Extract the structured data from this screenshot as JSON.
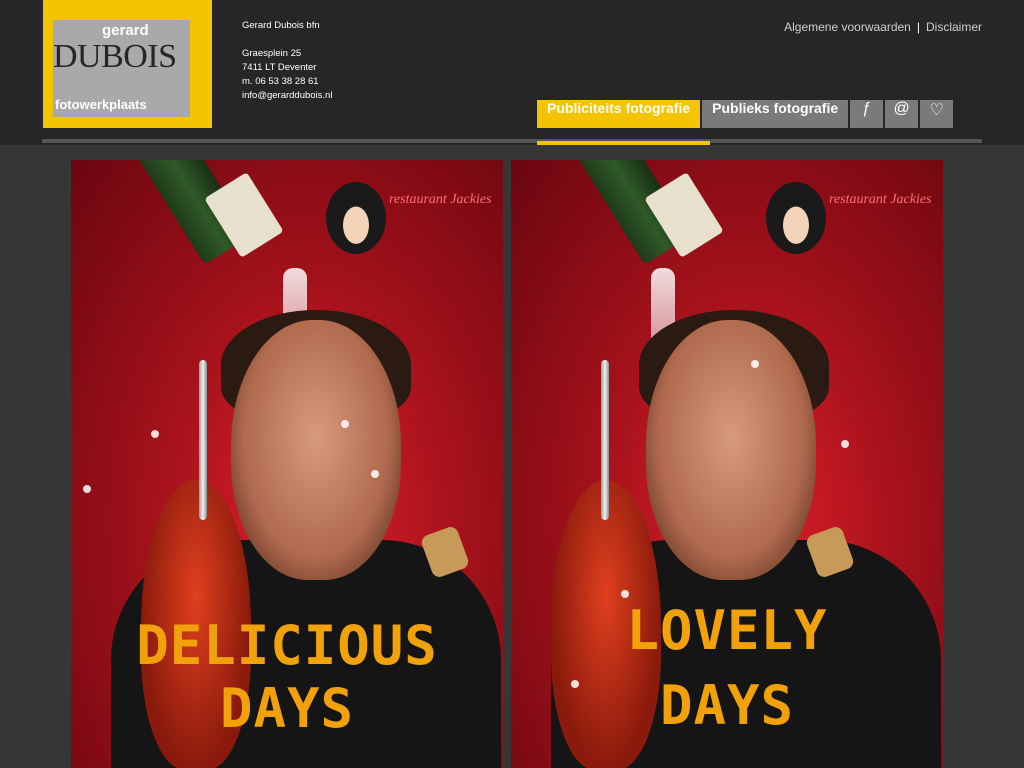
{
  "logo": {
    "first_name": "gerard",
    "last_name": "DUBOIS",
    "tagline": "fotowerkplaats"
  },
  "contact": {
    "company": "Gerard Dubois bfn",
    "street": "Graesplein 25",
    "city": "7411 LT Deventer",
    "phone": "m. 06 53 38 28 61",
    "email": "info@gerarddubois.nl"
  },
  "toplinks": {
    "terms": "Algemene voorwaarden",
    "separator": "|",
    "disclaimer": "Disclaimer"
  },
  "nav": {
    "items": [
      {
        "label": "Publiciteits fotografie",
        "active": true
      },
      {
        "label": "Publieks fotografie",
        "active": false
      }
    ],
    "icons": [
      {
        "name": "facebook-icon",
        "glyph": "ƒ"
      },
      {
        "name": "at-icon",
        "glyph": "@"
      },
      {
        "name": "heart-icon",
        "glyph": "♡"
      }
    ]
  },
  "posters": [
    {
      "brand": "restaurant Jackies",
      "slogan_line1": "DELICIOUS",
      "slogan_line2": "DAYS"
    },
    {
      "brand": "restaurant Jackies",
      "slogan_line1": "LOVELY",
      "slogan_line2": "DAYS"
    }
  ],
  "colors": {
    "accent": "#f5c400",
    "header_bg": "#262626",
    "page_bg": "#363636",
    "nav_inactive": "#7a7a7a",
    "slogan": "#f1a20a"
  }
}
